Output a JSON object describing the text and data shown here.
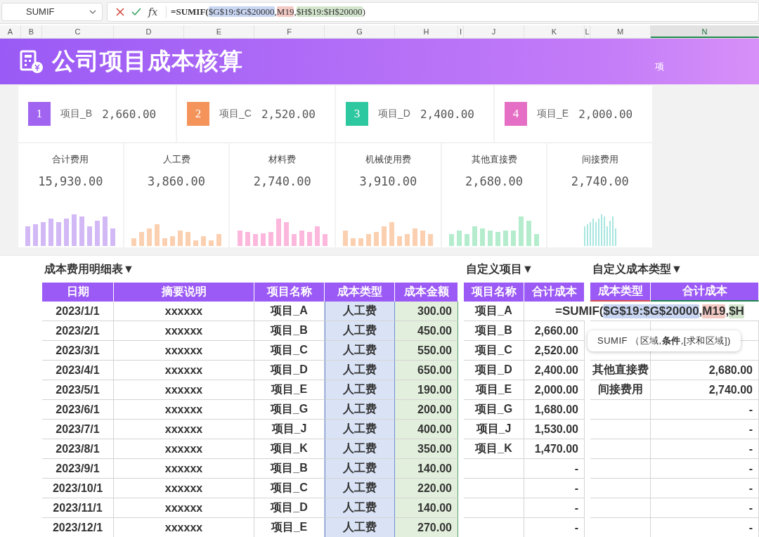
{
  "name_box": {
    "value": "SUMIF"
  },
  "formula_bar": {
    "fx": "fx",
    "formula": [
      {
        "text": "=SUMIF(",
        "kind": "plain"
      },
      {
        "text": "$G$19:$G$20000",
        "kind": "ref",
        "color": "#c9d6f3"
      },
      {
        "text": ",",
        "kind": "plain"
      },
      {
        "text": "M19",
        "kind": "ref",
        "color": "#f3c9c4"
      },
      {
        "text": ",",
        "kind": "plain"
      },
      {
        "text": "$H$19:$H$20000",
        "kind": "ref",
        "color": "#d3e6cd"
      },
      {
        "text": ")",
        "kind": "plain"
      }
    ]
  },
  "column_headers": [
    {
      "label": "A",
      "selected": false
    },
    {
      "label": "B",
      "selected": false
    },
    {
      "label": "C",
      "selected": false
    },
    {
      "label": "D",
      "selected": false
    },
    {
      "label": "E",
      "selected": false
    },
    {
      "label": "F",
      "selected": false
    },
    {
      "label": "G",
      "selected": false
    },
    {
      "label": "H",
      "selected": false
    },
    {
      "label": "I",
      "selected": false
    },
    {
      "label": "J",
      "selected": false
    },
    {
      "label": "K",
      "selected": false
    },
    {
      "label": "L",
      "selected": false
    },
    {
      "label": "M",
      "selected": false
    },
    {
      "label": "N",
      "selected": true
    }
  ],
  "banner": {
    "title": "公司项目成本核算",
    "note": "项"
  },
  "project_cards": [
    {
      "rank": "1",
      "name": "项目_B",
      "amount": "2,660.00",
      "color": "#a064f0"
    },
    {
      "rank": "2",
      "name": "项目_C",
      "amount": "2,520.00",
      "color": "#f4935a"
    },
    {
      "rank": "3",
      "name": "项目_D",
      "amount": "2,400.00",
      "color": "#2ec8a0"
    },
    {
      "rank": "4",
      "name": "项目_E",
      "amount": "2,000.00",
      "color": "#e46fc4"
    }
  ],
  "cost_cards": [
    {
      "label": "合计费用",
      "amount": "15,930.00",
      "color": "#d2b8f5"
    },
    {
      "label": "人工费",
      "amount": "3,860.00",
      "color": "#fbd0b0"
    },
    {
      "label": "材料费",
      "amount": "2,740.00",
      "color": "#fbb8dc"
    },
    {
      "label": "机械使用费",
      "amount": "3,910.00",
      "color": "#fbd0b0"
    },
    {
      "label": "其他直接费",
      "amount": "2,680.00",
      "color": "#b4eccd"
    },
    {
      "label": "间接费用",
      "amount": "2,740.00",
      "color": "#a8e6e0"
    }
  ],
  "detail": {
    "title": "成本费用明细表▼",
    "columns": [
      "日期",
      "摘要说明",
      "项目名称",
      "成本类型",
      "成本金额"
    ],
    "rows": [
      [
        "2023/1/1",
        "xxxxxx",
        "项目_A",
        "人工费",
        "300.00"
      ],
      [
        "2023/2/1",
        "xxxxxx",
        "项目_B",
        "人工费",
        "450.00"
      ],
      [
        "2023/3/1",
        "xxxxxx",
        "项目_C",
        "人工费",
        "550.00"
      ],
      [
        "2023/4/1",
        "xxxxxx",
        "项目_D",
        "人工费",
        "650.00"
      ],
      [
        "2023/5/1",
        "xxxxxx",
        "项目_E",
        "人工费",
        "190.00"
      ],
      [
        "2023/6/1",
        "xxxxxx",
        "项目_G",
        "人工费",
        "200.00"
      ],
      [
        "2023/7/1",
        "xxxxxx",
        "项目_J",
        "人工费",
        "400.00"
      ],
      [
        "2023/8/1",
        "xxxxxx",
        "项目_K",
        "人工费",
        "350.00"
      ],
      [
        "2023/9/1",
        "xxxxxx",
        "项目_B",
        "人工费",
        "140.00"
      ],
      [
        "2023/10/1",
        "xxxxxx",
        "项目_C",
        "人工费",
        "220.00"
      ],
      [
        "2023/11/1",
        "xxxxxx",
        "项目_D",
        "人工费",
        "140.00"
      ],
      [
        "2023/12/1",
        "xxxxxx",
        "项目_E",
        "人工费",
        "270.00"
      ]
    ]
  },
  "project_summary": {
    "title": "自定义项目▼",
    "columns": [
      "项目名称",
      "合计成本"
    ],
    "rows": [
      {
        "name": "项目_A"
      },
      {
        "name": "项目_B",
        "total": "2,660.00"
      },
      {
        "name": "项目_C",
        "total": "2,520.00"
      },
      {
        "name": "项目_D",
        "total": "2,400.00"
      },
      {
        "name": "项目_E",
        "total": "2,000.00"
      },
      {
        "name": "项目_G",
        "total": "1,680.00"
      },
      {
        "name": "项目_J",
        "total": "1,530.00"
      },
      {
        "name": "项目_K",
        "total": "1,470.00"
      },
      {
        "total": "-"
      },
      {
        "total": "-"
      },
      {
        "total": "-"
      },
      {
        "total": "-"
      }
    ]
  },
  "type_summary": {
    "title": "自定义成本类型▼",
    "columns": [
      "成本类型",
      "合计成本"
    ],
    "rows": [
      {},
      {},
      {},
      {
        "name": "其他直接费",
        "total": "2,680.00"
      },
      {
        "name": "间接费用",
        "total": "2,740.00"
      },
      {
        "total": "-"
      },
      {
        "total": "-"
      },
      {
        "total": "-"
      },
      {
        "total": "-"
      },
      {
        "total": "-"
      },
      {
        "total": "-"
      },
      {
        "total": "-"
      }
    ]
  },
  "cell_editor": {
    "formula": [
      {
        "text": "=SUMIF(",
        "kind": "plain"
      },
      {
        "text": "$G$19:$G$20000",
        "kind": "ref",
        "color": "#c9d6f3"
      },
      {
        "text": ",",
        "kind": "plain"
      },
      {
        "text": "M19",
        "kind": "ref",
        "color": "#f3c9c4"
      },
      {
        "text": ",",
        "kind": "plain"
      },
      {
        "text": "$H",
        "kind": "ref",
        "color": "#d3e6cd"
      }
    ]
  },
  "tooltip": {
    "text": "SUMIF （区域,**条件**,[求和区域])"
  }
}
